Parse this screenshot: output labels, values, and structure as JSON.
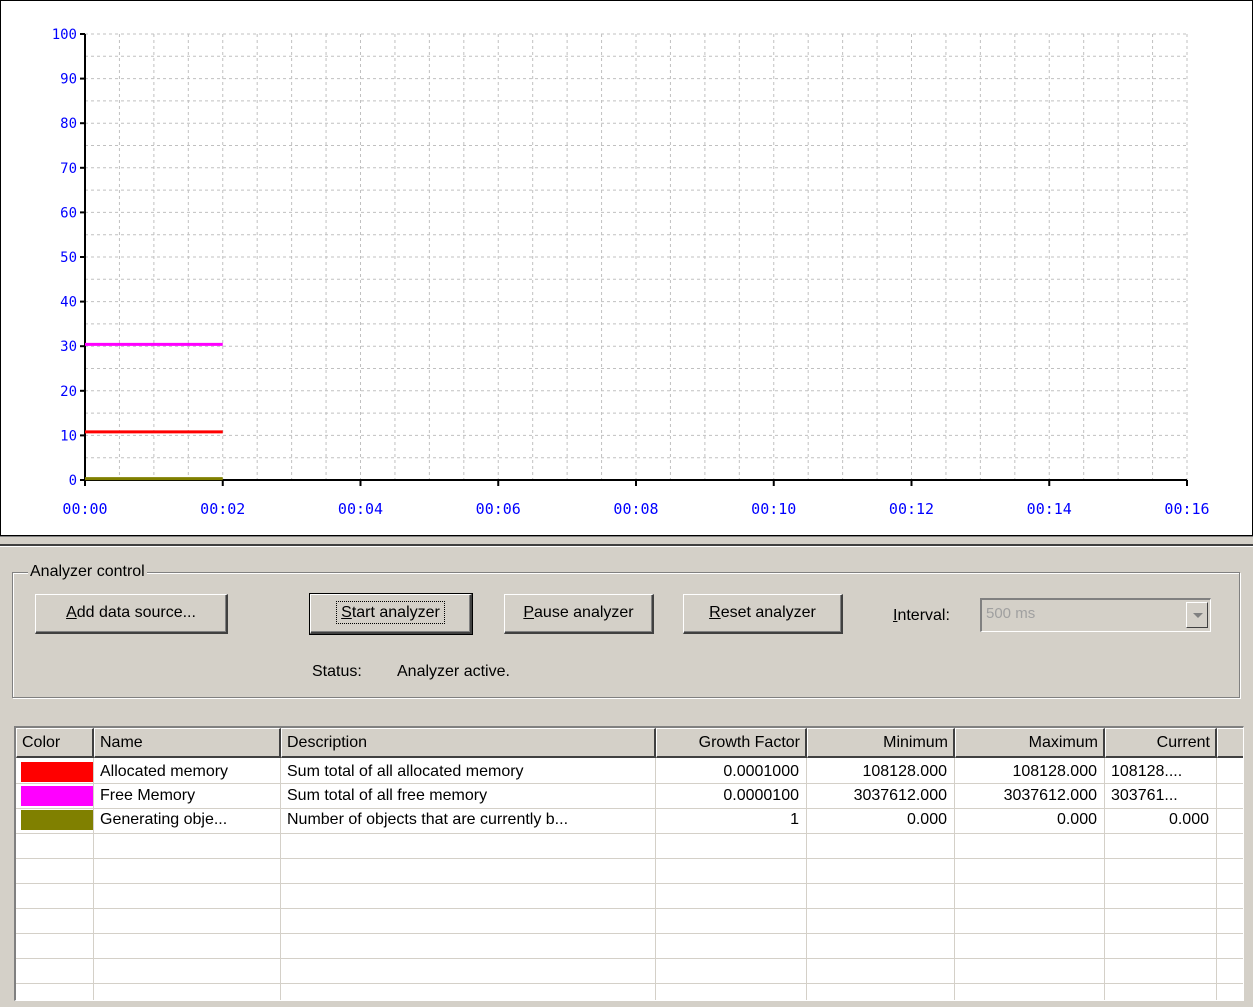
{
  "chart_data": {
    "type": "line",
    "x_ticks": [
      "00:00",
      "00:02",
      "00:04",
      "00:06",
      "00:08",
      "00:10",
      "00:12",
      "00:14",
      "00:16"
    ],
    "y_ticks": [
      "0",
      "10",
      "20",
      "30",
      "40",
      "50",
      "60",
      "70",
      "80",
      "90",
      "100"
    ],
    "xlim": [
      0,
      16
    ],
    "ylim": [
      0,
      100
    ],
    "grid": true,
    "series": [
      {
        "name": "Allocated memory",
        "color": "#ff0000",
        "x": [
          0,
          2
        ],
        "y": [
          10.8,
          10.8
        ]
      },
      {
        "name": "Free Memory",
        "color": "#ff00ff",
        "x": [
          0,
          2
        ],
        "y": [
          30.4,
          30.4
        ]
      },
      {
        "name": "Generating obje...",
        "color": "#808000",
        "x": [
          0,
          2
        ],
        "y": [
          0.3,
          0.3
        ]
      }
    ]
  },
  "control": {
    "group_title": "Analyzer control",
    "add_source": {
      "pre": "",
      "key": "A",
      "post": "dd data source..."
    },
    "start": {
      "pre": "",
      "key": "S",
      "post": "tart analyzer"
    },
    "pause": {
      "pre": "",
      "key": "P",
      "post": "ause analyzer"
    },
    "reset": {
      "pre": "",
      "key": "R",
      "post": "eset analyzer"
    },
    "interval_label": {
      "pre": "",
      "key": "I",
      "post": "nterval:"
    },
    "interval_value": "500 ms",
    "status_label": "Status:",
    "status_value": "Analyzer active."
  },
  "table": {
    "columns": [
      "Color",
      "Name",
      "Description",
      "Growth Factor",
      "Minimum",
      "Maximum",
      "Current"
    ],
    "rows": [
      {
        "color": "#ff0000",
        "name": "Allocated memory",
        "description": "Sum total of all allocated memory",
        "growth": "0.0001000",
        "min": "108128.000",
        "max": "108128.000",
        "current": "108128...."
      },
      {
        "color": "#ff00ff",
        "name": "Free Memory",
        "description": "Sum total of all free memory",
        "growth": "0.0000100",
        "min": "3037612.000",
        "max": "3037612.000",
        "current": "303761..."
      },
      {
        "color": "#808000",
        "name": "Generating obje...",
        "description": "Number of objects that are currently b...",
        "growth": "1",
        "min": "0.000",
        "max": "0.000",
        "current": "0.000"
      }
    ]
  }
}
